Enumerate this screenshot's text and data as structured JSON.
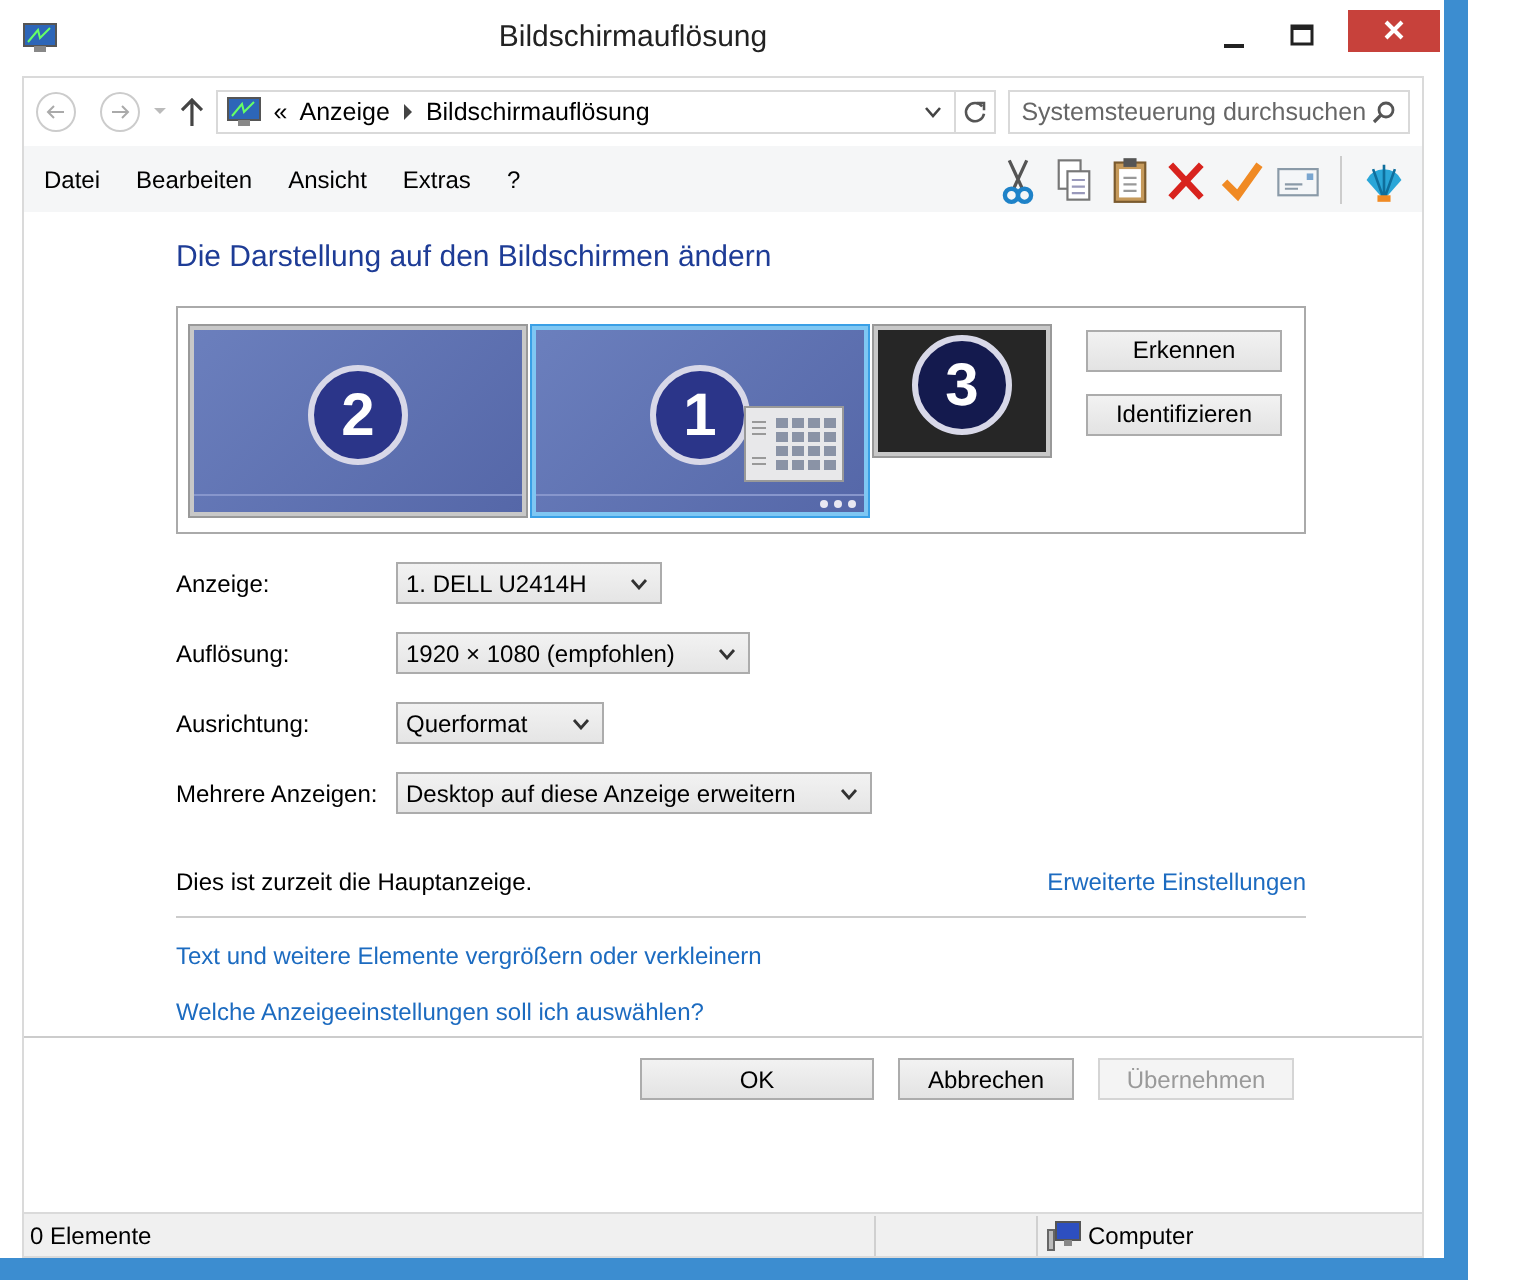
{
  "window": {
    "title": "Bildschirmauflösung"
  },
  "navigation": {
    "overflow": "«",
    "breadcrumb": [
      "Anzeige",
      "Bildschirmauflösung"
    ],
    "search": {
      "placeholder": "Systemsteuerung durchsuchen"
    }
  },
  "menu": [
    "Datei",
    "Bearbeiten",
    "Ansicht",
    "Extras",
    "?"
  ],
  "toolbar": [
    {
      "kind": "cut"
    },
    {
      "kind": "copy"
    },
    {
      "kind": "paste"
    },
    {
      "kind": "delete"
    },
    {
      "kind": "check"
    },
    {
      "kind": "card"
    },
    {
      "kind": "shell"
    }
  ],
  "heading": "Die Darstellung auf den Bildschirmen ändern",
  "monitors": [
    {
      "number": "2",
      "selected": false,
      "active": true,
      "primary": false
    },
    {
      "number": "1",
      "selected": true,
      "active": true,
      "primary": true
    },
    {
      "number": "3",
      "selected": false,
      "active": false,
      "primary": false
    }
  ],
  "monitor_buttons": [
    "Erkennen",
    "Identifizieren"
  ],
  "settings": [
    {
      "label": "Anzeige:",
      "value": "1. DELL U2414H"
    },
    {
      "label": "Auflösung:",
      "value": "1920 × 1080 (empfohlen)"
    },
    {
      "label": "Ausrichtung:",
      "value": "Querformat"
    },
    {
      "label": "Mehrere Anzeigen:",
      "value": "Desktop auf diese Anzeige erweitern"
    }
  ],
  "primary_note": "Dies ist zurzeit die Hauptanzeige.",
  "advanced_link": "Erweiterte Einstellungen",
  "links": [
    "Text und weitere Elemente vergrößern oder verkleinern",
    "Welche Anzeigeeinstellungen soll ich auswählen?"
  ],
  "buttons": [
    {
      "label": "OK",
      "disabled": false
    },
    {
      "label": "Abbrechen",
      "disabled": false
    },
    {
      "label": "Übernehmen",
      "disabled": true
    }
  ],
  "status_bar": {
    "count": "0 Elemente",
    "location": "Computer"
  }
}
